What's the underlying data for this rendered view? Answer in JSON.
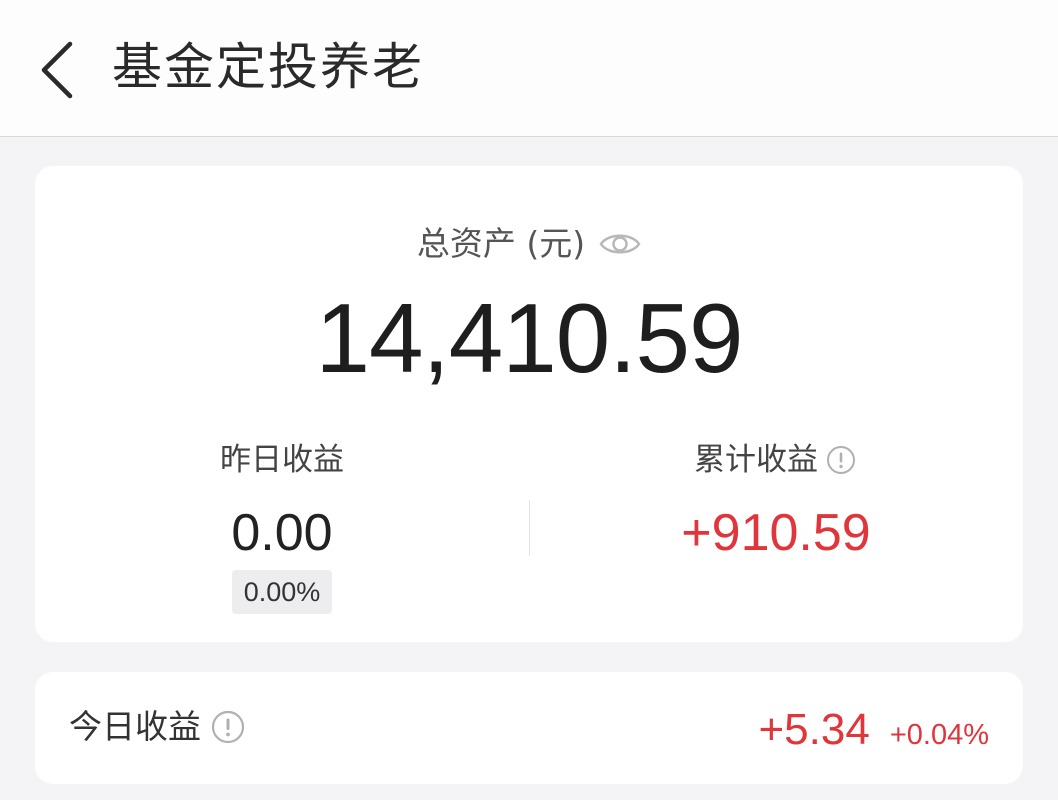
{
  "header": {
    "back_icon": "chevron-left-icon",
    "title": "基金定投养老"
  },
  "summary": {
    "total_label": "总资产 (元)",
    "eye_icon": "eye-icon",
    "total_value": "14,410.59",
    "yesterday": {
      "label": "昨日收益",
      "value": "0.00",
      "percent": "0.00%"
    },
    "cumulative": {
      "label": "累计收益",
      "info_icon": "info-icon",
      "value": "+910.59",
      "color": "#e0353b"
    }
  },
  "today": {
    "label": "今日收益",
    "info_icon": "info-icon",
    "amount": "+5.34",
    "percent": "+0.04%",
    "color": "#e0353b"
  }
}
